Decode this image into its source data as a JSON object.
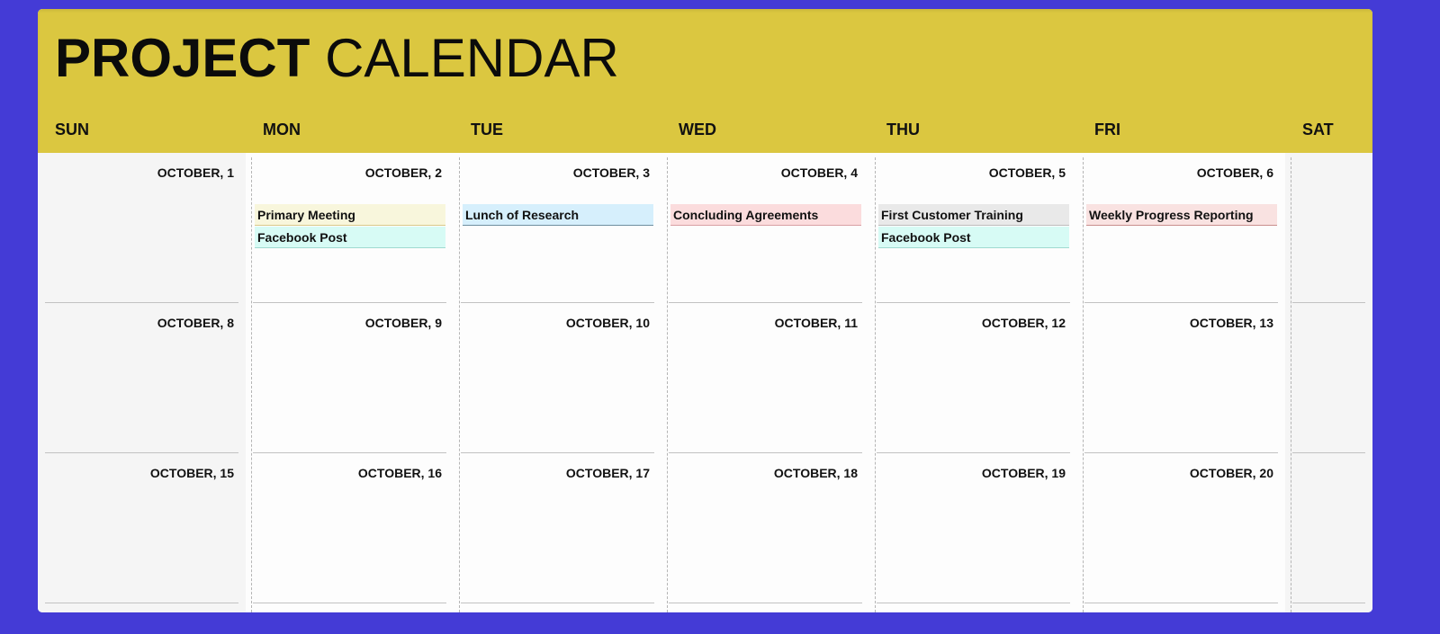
{
  "header": {
    "title_bold": "PROJECT",
    "title_light": "CALENDAR",
    "background": "#dbc740"
  },
  "days_of_week": [
    "SUN",
    "MON",
    "TUE",
    "WED",
    "THU",
    "FRI",
    "SAT"
  ],
  "weeks": [
    {
      "days": [
        {
          "date": "OCTOBER, 1",
          "events": []
        },
        {
          "date": "OCTOBER, 2",
          "events": [
            {
              "title": "Primary Meeting",
              "bg": "#f8f6dc",
              "border": "#d9c98a"
            },
            {
              "title": "Facebook Post",
              "bg": "#d7fbf5",
              "border": "#9fd9d0"
            }
          ]
        },
        {
          "date": "OCTOBER, 3",
          "events": [
            {
              "title": "Lunch of Research",
              "bg": "#d6effc",
              "border": "#6f8fa0"
            }
          ]
        },
        {
          "date": "OCTOBER, 4",
          "events": [
            {
              "title": "Concluding Agreements",
              "bg": "#fbdcdd",
              "border": "#d9a0a4"
            }
          ]
        },
        {
          "date": "OCTOBER, 5",
          "events": [
            {
              "title": "First Customer Training",
              "bg": "#e9e9e9",
              "border": "#bdbdbd"
            },
            {
              "title": "Facebook Post",
              "bg": "#d7fbf5",
              "border": "#9fd9d0"
            }
          ]
        },
        {
          "date": "OCTOBER, 6",
          "events": [
            {
              "title": "Weekly Progress Reporting",
              "bg": "#f9e2e1",
              "border": "#c98f8d"
            }
          ]
        },
        {
          "date": "",
          "events": []
        }
      ]
    },
    {
      "days": [
        {
          "date": "OCTOBER, 8",
          "events": []
        },
        {
          "date": "OCTOBER, 9",
          "events": []
        },
        {
          "date": "OCTOBER, 10",
          "events": []
        },
        {
          "date": "OCTOBER, 11",
          "events": []
        },
        {
          "date": "OCTOBER, 12",
          "events": []
        },
        {
          "date": "OCTOBER, 13",
          "events": []
        },
        {
          "date": "",
          "events": []
        }
      ]
    },
    {
      "days": [
        {
          "date": "OCTOBER, 15",
          "events": []
        },
        {
          "date": "OCTOBER, 16",
          "events": []
        },
        {
          "date": "OCTOBER, 17",
          "events": []
        },
        {
          "date": "OCTOBER, 18",
          "events": []
        },
        {
          "date": "OCTOBER, 19",
          "events": []
        },
        {
          "date": "OCTOBER, 20",
          "events": []
        },
        {
          "date": "",
          "events": []
        }
      ]
    }
  ]
}
